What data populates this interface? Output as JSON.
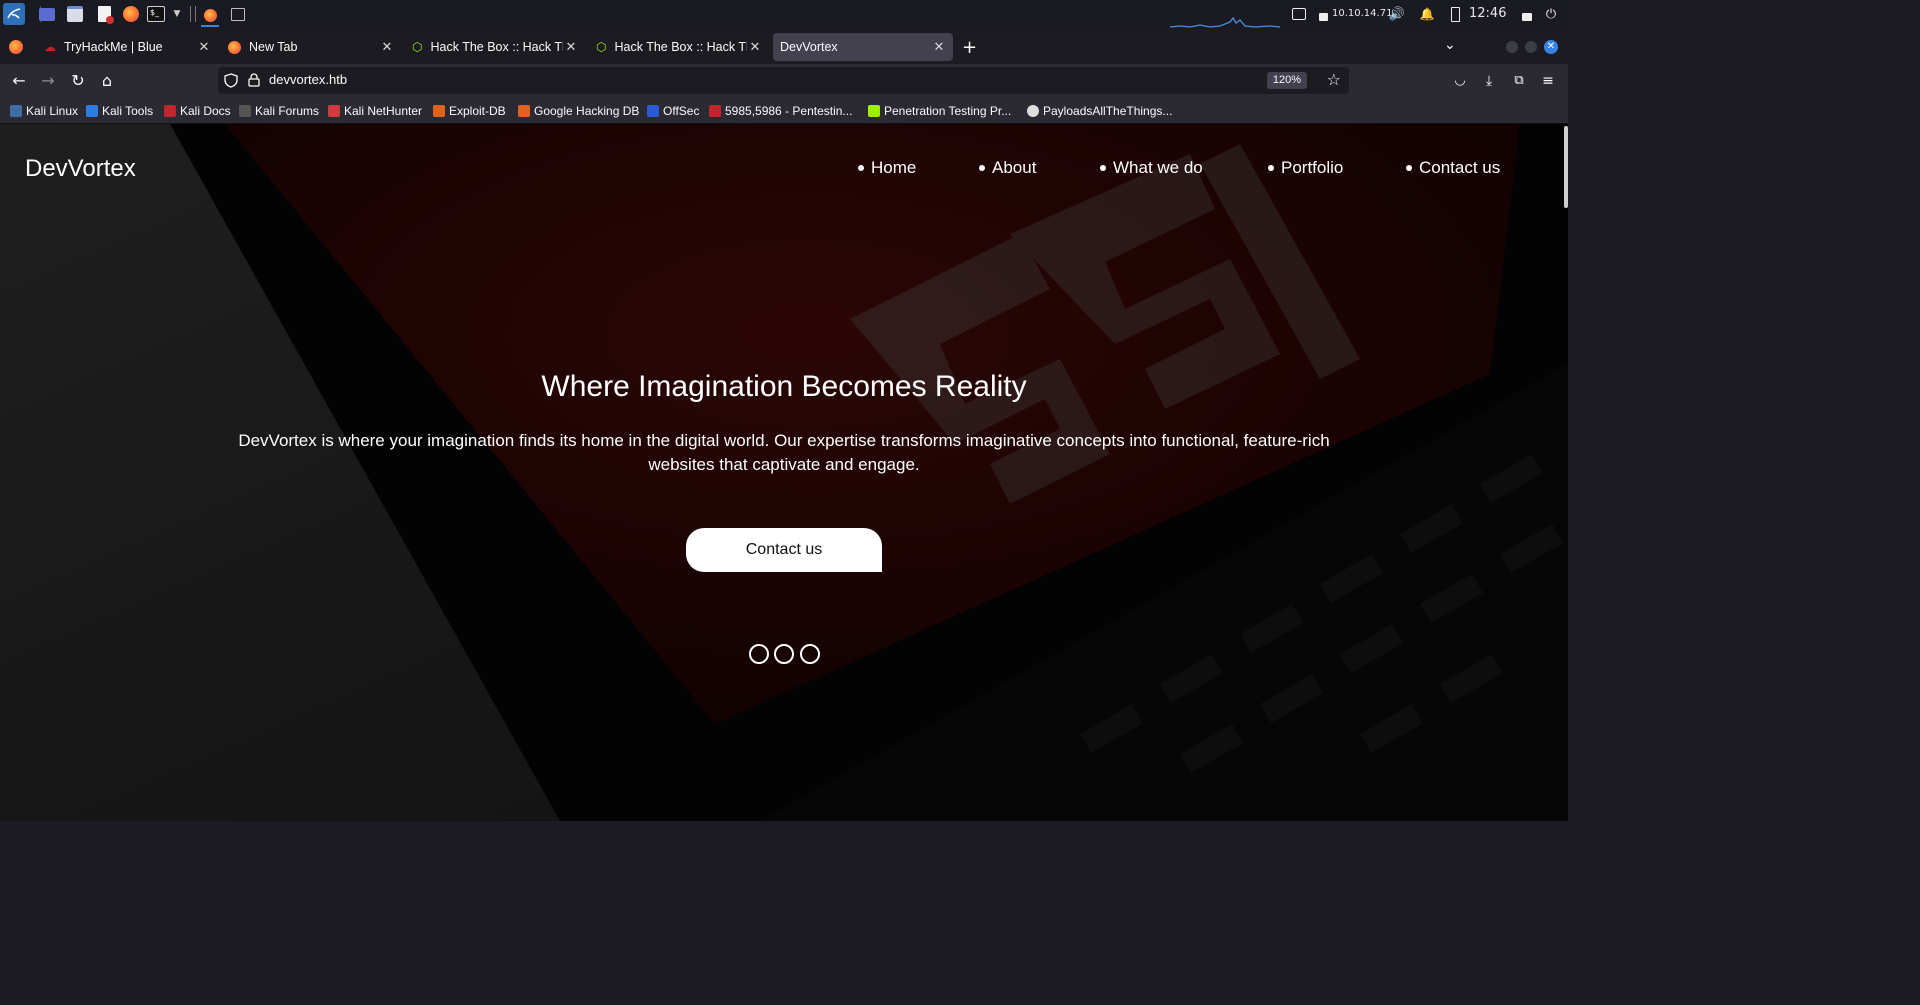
{
  "taskbar": {
    "ip_address": "10.10.14.71",
    "clock": "12:46"
  },
  "tabs": [
    {
      "label": "TryHackMe | Blue"
    },
    {
      "label": "New Tab"
    },
    {
      "label": "Hack The Box :: Hack The"
    },
    {
      "label": "Hack The Box :: Hack The"
    },
    {
      "label": "DevVortex"
    }
  ],
  "navbar": {
    "url": "devvortex.htb",
    "zoom": "120%"
  },
  "bookmarks": [
    {
      "label": "Kali Linux",
      "color": "#3b6ea5"
    },
    {
      "label": "Kali Tools",
      "color": "#2f7de1"
    },
    {
      "label": "Kali Docs",
      "color": "#c0262d"
    },
    {
      "label": "Kali Forums",
      "color": "#555555"
    },
    {
      "label": "Kali NetHunter",
      "color": "#d23b3b"
    },
    {
      "label": "Exploit-DB",
      "color": "#e0621f"
    },
    {
      "label": "Google Hacking DB",
      "color": "#e0621f"
    },
    {
      "label": "OffSec",
      "color": "#2a5bd7"
    },
    {
      "label": "5985,5986 - Pentestin...",
      "color": "#c0262d"
    },
    {
      "label": "Penetration Testing Pr...",
      "color": "#9fef00"
    },
    {
      "label": "PayloadsAllTheThings...",
      "color": "#dddddd"
    }
  ],
  "site": {
    "brand": "DevVortex",
    "menu": [
      "Home",
      "About",
      "What we do",
      "Portfolio",
      "Contact us"
    ],
    "hero_title": "Where Imagination Becomes Reality",
    "hero_text": "DevVortex is where your imagination finds its home in the digital world. Our expertise transforms imaginative concepts into functional, feature-rich websites that captivate and engage.",
    "cta_label": "Contact us",
    "slide_count": 3
  }
}
